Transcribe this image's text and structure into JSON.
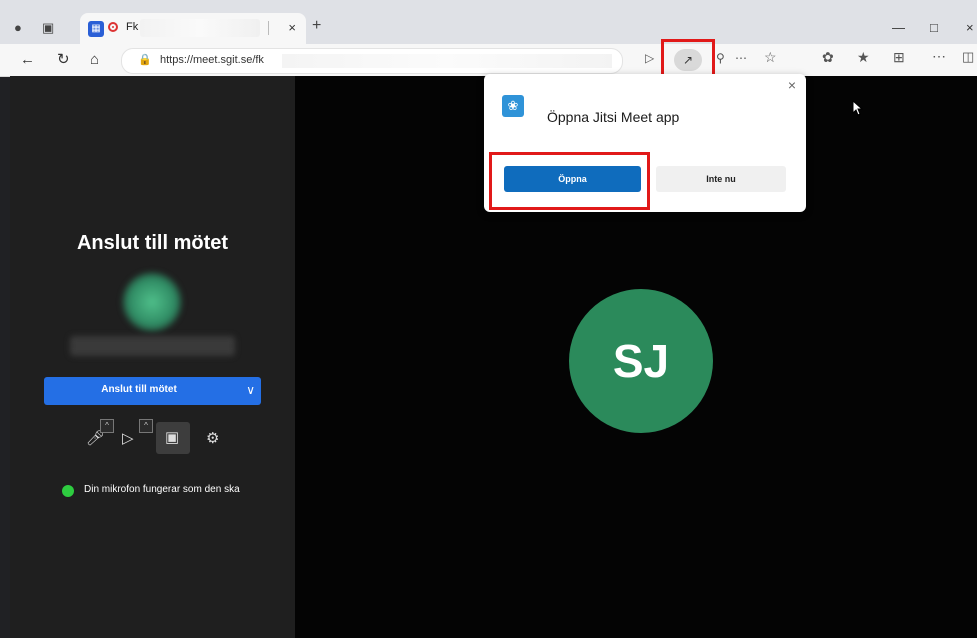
{
  "browser": {
    "tab_title": "Fk",
    "tab_close": "×",
    "new_tab": "+",
    "url": "https://meet.sgit.se/fk",
    "window_minimize": "—",
    "window_maximize": "□",
    "window_close": "×"
  },
  "prejoin": {
    "title": "Anslut till mötet",
    "join_button": "Anslut till mötet",
    "mic_status": "Din mikrofon fungerar som den ska"
  },
  "participant": {
    "initials": "SJ",
    "avatar_color": "#2b8a5b"
  },
  "popup": {
    "title": "Öppna Jitsi Meet app",
    "open_button": "Öppna",
    "not_now_button": "Inte nu",
    "close": "×"
  },
  "colors": {
    "accent_blue": "#246fe5",
    "popup_primary": "#0f6cbd",
    "highlight_red": "#e11919",
    "status_green": "#2ecc40"
  }
}
